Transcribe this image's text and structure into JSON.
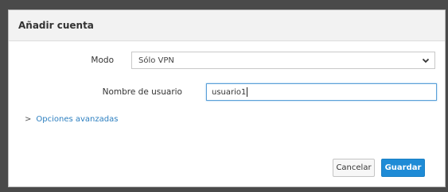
{
  "dialog": {
    "title": "Añadir cuenta"
  },
  "form": {
    "mode_label": "Modo",
    "mode_value": "Sólo VPN",
    "username_label": "Nombre de usuario",
    "username_value": "usuario1",
    "advanced_options": "Opciones avanzadas"
  },
  "buttons": {
    "cancel": "Cancelar",
    "save": "Guardar"
  },
  "colors": {
    "accent": "#1e8bd6",
    "link": "#2c7fc0",
    "focus_border": "#5aa0d8"
  },
  "icons": {
    "select_chevron": "chevron-down-icon",
    "advanced_toggle": "chevron-right-icon"
  }
}
